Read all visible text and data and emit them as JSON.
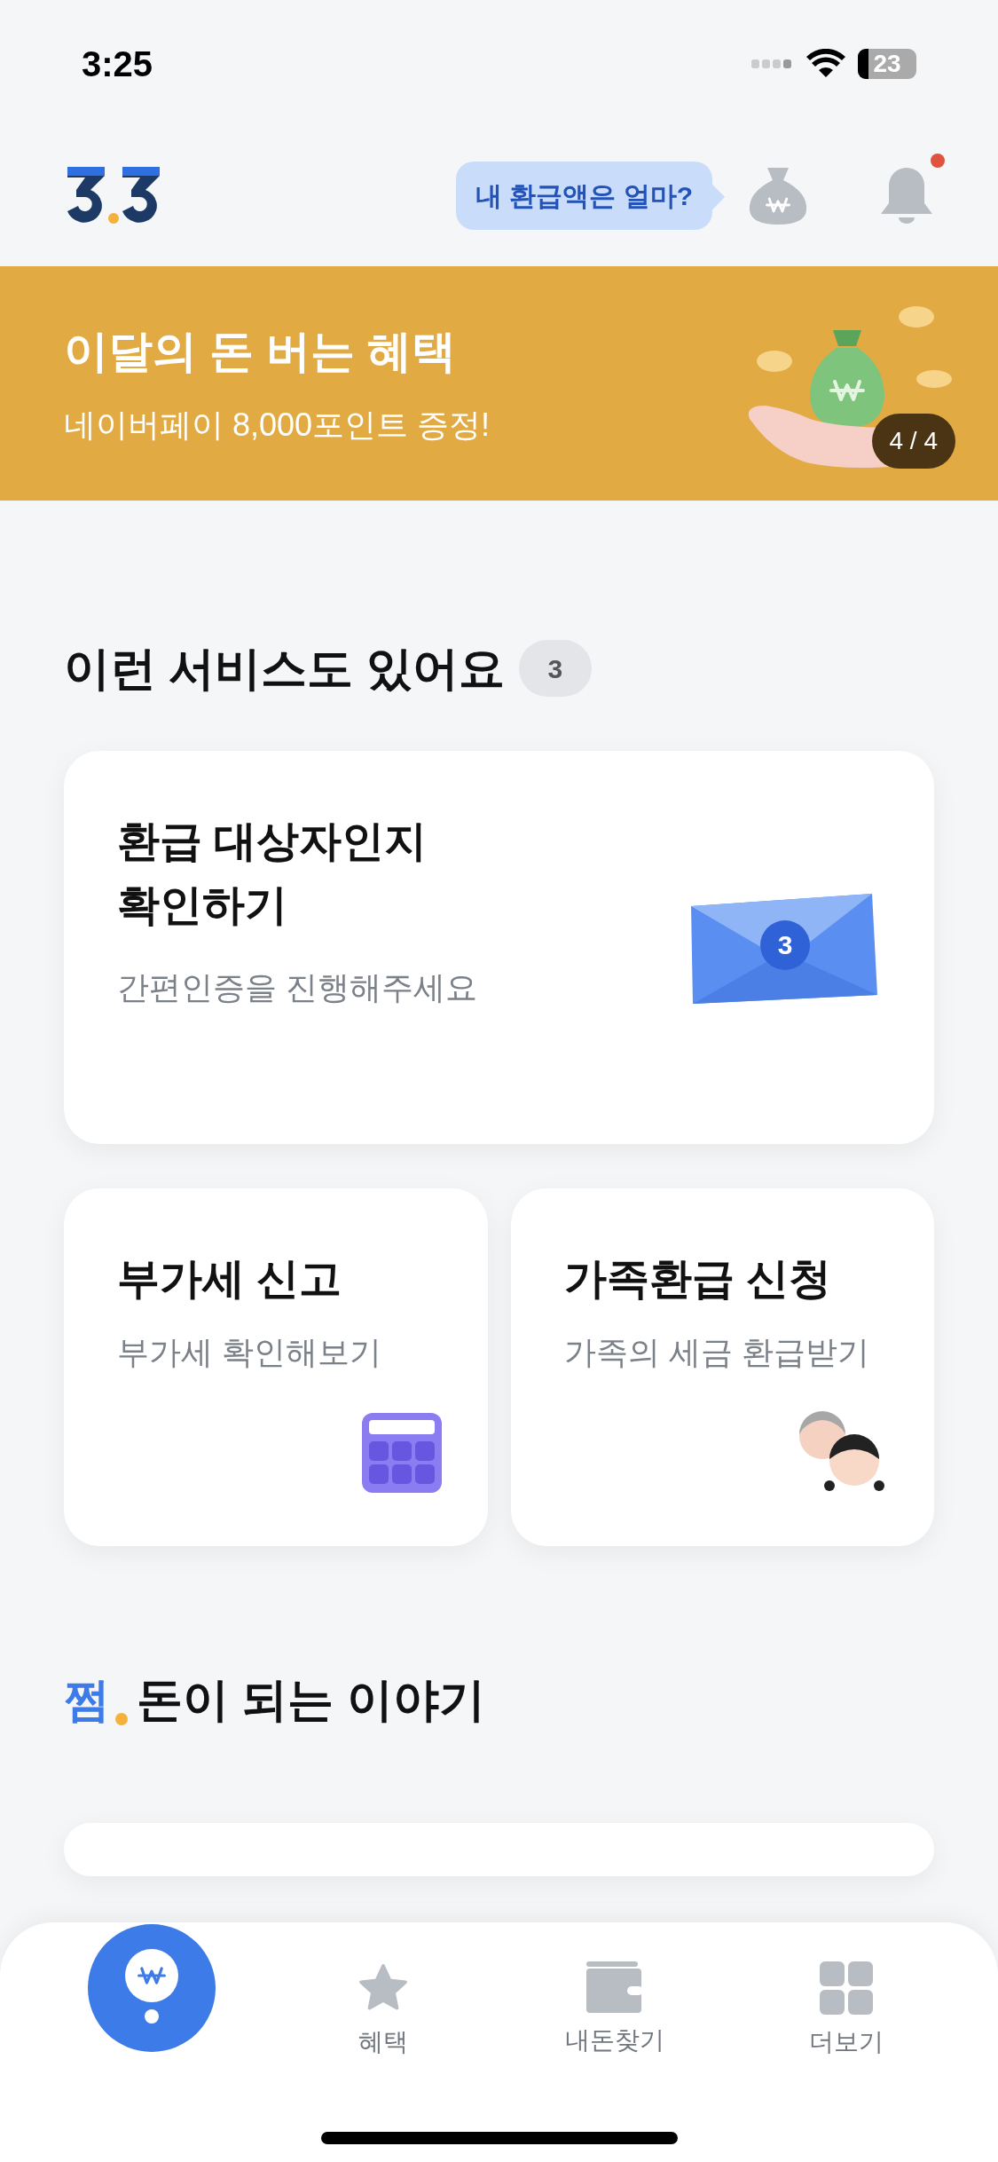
{
  "status_bar": {
    "time": "3:25",
    "battery": "23"
  },
  "header": {
    "tooltip": "내 환급액은 얼마?",
    "notification_unread": true
  },
  "banner": {
    "title": "이달의 돈 버는 혜택",
    "subtitle": "네이버페이 8,000포인트 증정!",
    "page": "4 / 4"
  },
  "services": {
    "title": "이런 서비스도 있어요",
    "count": "3",
    "cards": [
      {
        "kind": "envelope",
        "title": "환급 대상자인지\n확인하기",
        "subtitle": "간편인증을 진행해주세요",
        "badge": "3"
      },
      {
        "kind": "calculator",
        "title": "부가세 신고",
        "subtitle": "부가세 확인해보기"
      },
      {
        "kind": "family",
        "title": "가족환급 신청",
        "subtitle": "가족의 세금 환급받기"
      }
    ]
  },
  "stories": {
    "brand": "쩜",
    "title": "돈이 되는 이야기"
  },
  "tab_bar": [
    {
      "kind": "home",
      "selected": true
    },
    {
      "kind": "star",
      "label": "혜택",
      "selected": false
    },
    {
      "kind": "wallet",
      "label": "내돈찾기",
      "selected": false
    },
    {
      "kind": "grid",
      "label": "더보기",
      "selected": false
    }
  ]
}
